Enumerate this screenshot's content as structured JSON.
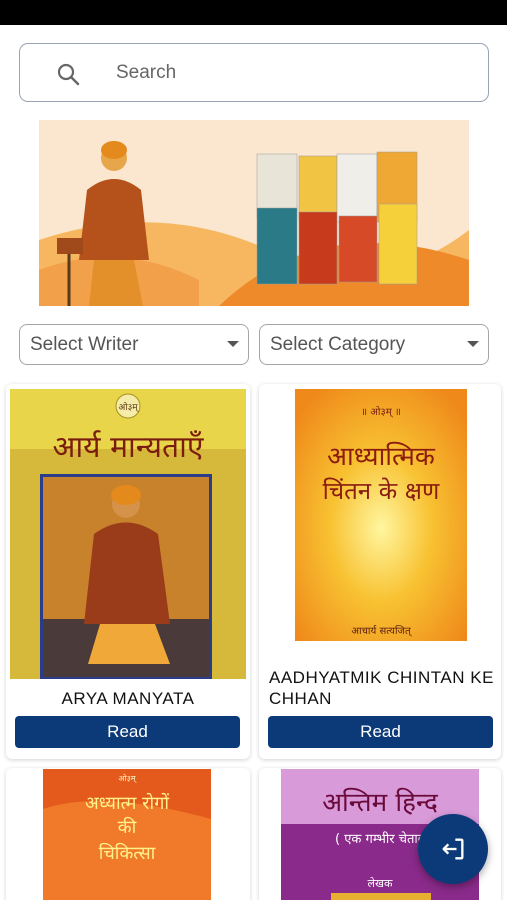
{
  "search": {
    "placeholder": "Search",
    "icon": "search-icon"
  },
  "banner": {
    "description_icon": "banner-image"
  },
  "filters": {
    "writer": {
      "selected": "Select Writer"
    },
    "category": {
      "selected": "Select Category"
    }
  },
  "books": [
    {
      "title": "ARYA MANYATA",
      "read_label": "Read",
      "cover_text_top": "ओ३म्",
      "cover_text_main": "आर्य मान्यताएँ"
    },
    {
      "title": "AADHYATMIK CHINTAN KE CHHAN",
      "read_label": "Read",
      "cover_text_top": "॥ ओ३म् ॥",
      "cover_text_main_1": "आध्यात्मिक",
      "cover_text_main_2": "चिंतन के क्षण",
      "cover_author": "आचार्य सत्यजित्"
    },
    {
      "cover_text_top": "ओ३म्",
      "cover_text_main_1": "अध्यात्म रोगों",
      "cover_text_main_2": "की",
      "cover_text_main_3": "चिकित्सा"
    },
    {
      "cover_text_main_1": "अन्तिम हिन्द",
      "cover_text_main_2": "( एक गम्भीर चेताव",
      "cover_author_label": "लेखक"
    }
  ],
  "fab": {
    "icon": "logout-icon"
  },
  "colors": {
    "primary": "#0c3a78"
  }
}
